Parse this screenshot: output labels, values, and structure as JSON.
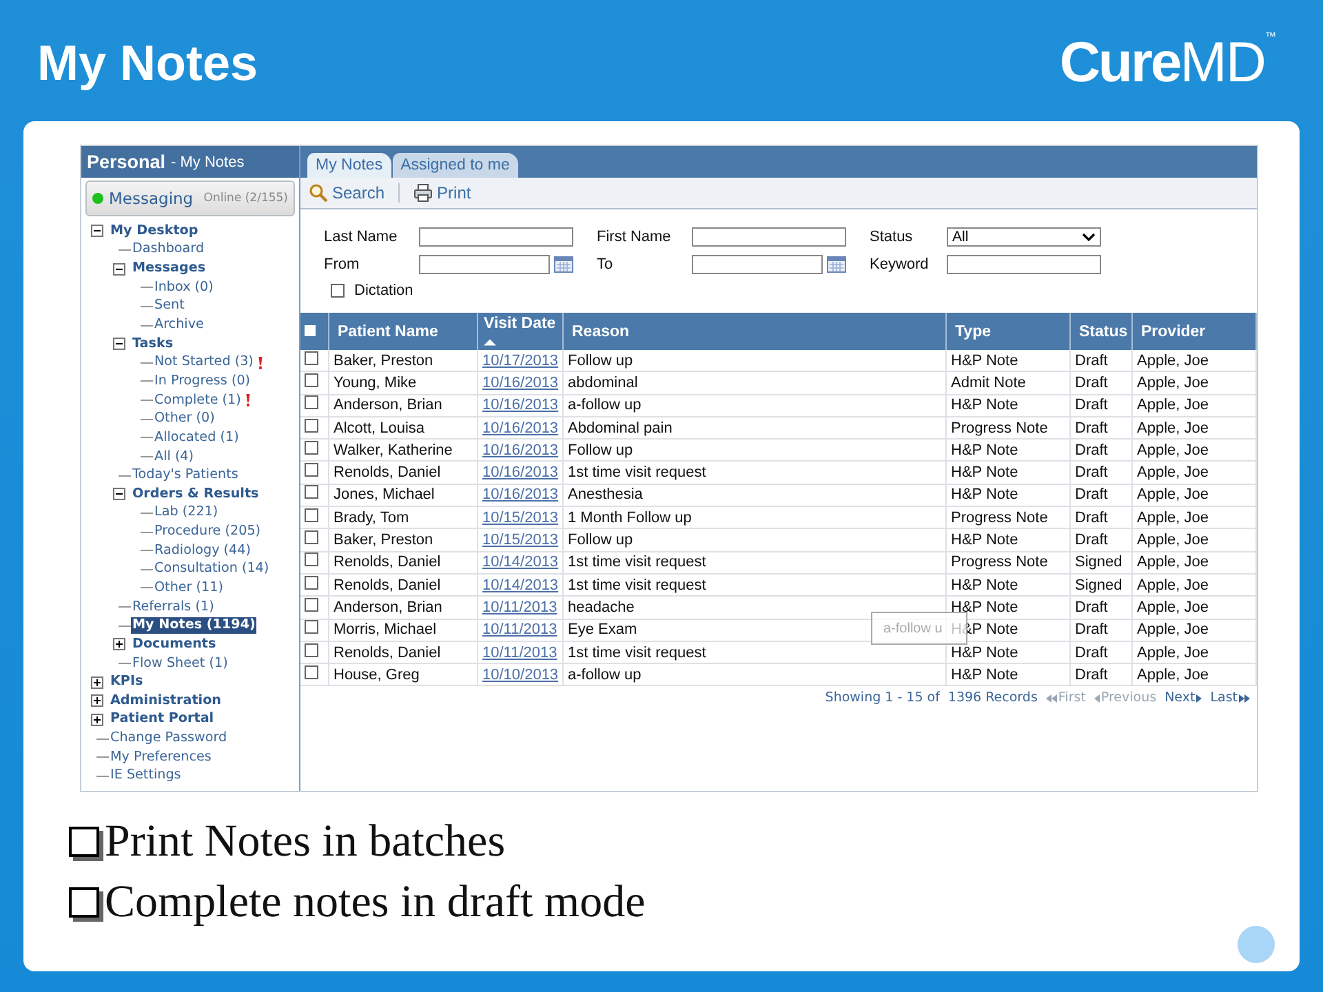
{
  "slide": {
    "title": "My Notes",
    "logo": "**Cure**MD$^{™}$",
    "bullets": [
      "Print Notes in batches",
      "Complete notes in draft mode"
    ]
  },
  "sidebar": {
    "title": "Personal",
    "subtitle": "- My Notes",
    "messaging": {
      "label": "Messaging",
      "online": true,
      "status": "Online (2/155)"
    },
    "tree": [
      {
        "label": "My Desktop",
        "kind": "folder",
        "expanded": true,
        "selected": false,
        "alert": false,
        "children": [
          {
            "label": "Dashboard",
            "kind": "link",
            "selected": false,
            "alert": false
          },
          {
            "label": "Messages",
            "kind": "folder",
            "expanded": true,
            "selected": false,
            "alert": false,
            "children": [
              {
                "label": "Inbox (0)",
                "kind": "link",
                "selected": false,
                "alert": false
              },
              {
                "label": "Sent",
                "kind": "link",
                "selected": false,
                "alert": false
              },
              {
                "label": "Archive",
                "kind": "link",
                "selected": false,
                "alert": false
              }
            ]
          },
          {
            "label": "Tasks",
            "kind": "folder",
            "expanded": true,
            "selected": false,
            "alert": false,
            "children": [
              {
                "label": "Not Started (3)",
                "kind": "link",
                "selected": false,
                "alert": true
              },
              {
                "label": "In Progress (0)",
                "kind": "link",
                "selected": false,
                "alert": false
              },
              {
                "label": "Complete (1)",
                "kind": "link",
                "selected": false,
                "alert": true
              },
              {
                "label": "Other (0)",
                "kind": "link",
                "selected": false,
                "alert": false
              },
              {
                "label": "Allocated (1)",
                "kind": "link",
                "selected": false,
                "alert": false
              },
              {
                "label": "All (4)",
                "kind": "link",
                "selected": false,
                "alert": false
              }
            ]
          },
          {
            "label": "Today's Patients",
            "kind": "link",
            "selected": false,
            "alert": false
          },
          {
            "label": "Orders & Results",
            "kind": "folder",
            "expanded": true,
            "selected": false,
            "alert": false,
            "children": [
              {
                "label": "Lab (221)",
                "kind": "link",
                "selected": false,
                "alert": false
              },
              {
                "label": "Procedure (205)",
                "kind": "link",
                "selected": false,
                "alert": false
              },
              {
                "label": "Radiology (44)",
                "kind": "link",
                "selected": false,
                "alert": false
              },
              {
                "label": "Consultation (14)",
                "kind": "link",
                "selected": false,
                "alert": false
              },
              {
                "label": "Other (11)",
                "kind": "link",
                "selected": false,
                "alert": false
              }
            ]
          },
          {
            "label": "Referrals (1)",
            "kind": "link",
            "selected": false,
            "alert": false
          },
          {
            "label": "My Notes (1194)",
            "kind": "link",
            "selected": true,
            "alert": false
          },
          {
            "label": "Documents",
            "kind": "folder",
            "expanded": false,
            "selected": false,
            "alert": false
          },
          {
            "label": "Flow Sheet (1)",
            "kind": "link",
            "selected": false,
            "alert": false
          }
        ]
      },
      {
        "label": "KPIs",
        "kind": "folder",
        "expanded": false,
        "selected": false,
        "alert": false
      },
      {
        "label": "Administration",
        "kind": "folder",
        "expanded": false,
        "selected": false,
        "alert": false
      },
      {
        "label": "Patient Portal",
        "kind": "folder",
        "expanded": false,
        "selected": false,
        "alert": false
      },
      {
        "label": "Change Password",
        "kind": "link",
        "selected": false,
        "alert": false
      },
      {
        "label": "My Preferences",
        "kind": "link",
        "selected": false,
        "alert": false
      },
      {
        "label": "IE Settings",
        "kind": "link",
        "selected": false,
        "alert": false
      }
    ]
  },
  "tabs": [
    {
      "label": "My Notes",
      "selected": true
    },
    {
      "label": "Assigned to me",
      "selected": false
    }
  ],
  "toolbar": [
    {
      "label": "Search",
      "kind": "search"
    },
    {
      "label": "Print",
      "kind": "print"
    }
  ],
  "form": {
    "fields": [
      {
        "label": "Last Name",
        "kind": "text"
      },
      {
        "label": "First Name",
        "kind": "text"
      },
      {
        "label": "Status",
        "kind": "select",
        "value": "All"
      },
      {
        "label": "From",
        "kind": "date"
      },
      {
        "label": "To",
        "kind": "date"
      },
      {
        "label": "Keyword",
        "kind": "text"
      }
    ],
    "dictation": {
      "label": "Dictation",
      "checked": false
    }
  },
  "table": {
    "all_checked": false,
    "columns": [
      {
        "label": "Patient Name",
        "sorted": false
      },
      {
        "label": "Visit Date",
        "sorted": true
      },
      {
        "label": "Reason",
        "sorted": false
      },
      {
        "label": "Type",
        "sorted": false
      },
      {
        "label": "Status",
        "sorted": false
      },
      {
        "label": "Provider",
        "sorted": false
      }
    ],
    "rows": [
      {
        "checked": false,
        "patient": "Baker, Preston",
        "date": "10/17/2013",
        "reason": "Follow up",
        "type": "H&P Note",
        "status": "Draft",
        "provider": "Apple, Joe"
      },
      {
        "checked": false,
        "patient": "Young, Mike",
        "date": "10/16/2013",
        "reason": "abdominal",
        "type": "Admit Note",
        "status": "Draft",
        "provider": "Apple, Joe"
      },
      {
        "checked": false,
        "patient": "Anderson, Brian",
        "date": "10/16/2013",
        "reason": "a-follow up",
        "type": "H&P Note",
        "status": "Draft",
        "provider": "Apple, Joe"
      },
      {
        "checked": false,
        "patient": "Alcott, Louisa",
        "date": "10/16/2013",
        "reason": "Abdominal pain",
        "type": "Progress Note",
        "status": "Draft",
        "provider": "Apple, Joe"
      },
      {
        "checked": false,
        "patient": "Walker, Katherine",
        "date": "10/16/2013",
        "reason": "Follow up",
        "type": "H&P Note",
        "status": "Draft",
        "provider": "Apple, Joe"
      },
      {
        "checked": false,
        "patient": "Renolds, Daniel",
        "date": "10/16/2013",
        "reason": "1st time visit request",
        "type": "H&P Note",
        "status": "Draft",
        "provider": "Apple, Joe"
      },
      {
        "checked": false,
        "patient": "Jones, Michael",
        "date": "10/16/2013",
        "reason": "Anesthesia",
        "type": "H&P Note",
        "status": "Draft",
        "provider": "Apple, Joe"
      },
      {
        "checked": false,
        "patient": "Brady, Tom",
        "date": "10/15/2013",
        "reason": "1 Month Follow up",
        "type": "Progress Note",
        "status": "Draft",
        "provider": "Apple, Joe"
      },
      {
        "checked": false,
        "patient": "Baker, Preston",
        "date": "10/15/2013",
        "reason": "Follow up",
        "type": "H&P Note",
        "status": "Draft",
        "provider": "Apple, Joe"
      },
      {
        "checked": false,
        "patient": "Renolds, Daniel",
        "date": "10/14/2013",
        "reason": "1st time visit request",
        "type": "Progress Note",
        "status": "Signed",
        "provider": "Apple, Joe"
      },
      {
        "checked": false,
        "patient": "Renolds, Daniel",
        "date": "10/14/2013",
        "reason": "1st time visit request",
        "type": "H&P Note",
        "status": "Signed",
        "provider": "Apple, Joe"
      },
      {
        "checked": false,
        "patient": "Anderson, Brian",
        "date": "10/11/2013",
        "reason": "headache",
        "type": "H&P Note",
        "status": "Draft",
        "provider": "Apple, Joe"
      },
      {
        "checked": false,
        "patient": "Morris, Michael",
        "date": "10/11/2013",
        "reason": "Eye Exam",
        "type": "H&P Note",
        "status": "Draft",
        "provider": "Apple, Joe"
      },
      {
        "checked": false,
        "patient": "Renolds, Daniel",
        "date": "10/11/2013",
        "reason": "1st time visit request",
        "type": "H&P Note",
        "status": "Draft",
        "provider": "Apple, Joe"
      },
      {
        "checked": false,
        "patient": "House, Greg",
        "date": "10/10/2013",
        "reason": "a-follow up",
        "type": "H&P Note",
        "status": "Draft",
        "provider": "Apple, Joe"
      }
    ]
  },
  "tooltip": "a-follow u",
  "pager": {
    "summary": "Showing 1 - 15 of",
    "total": "1396 Records",
    "links": [
      {
        "label": "First",
        "kind": "first",
        "disabled": true
      },
      {
        "label": "Previous",
        "kind": "prev",
        "disabled": true
      },
      {
        "label": "Next",
        "kind": "next",
        "disabled": false
      },
      {
        "label": "Last",
        "kind": "last",
        "disabled": false
      }
    ]
  }
}
